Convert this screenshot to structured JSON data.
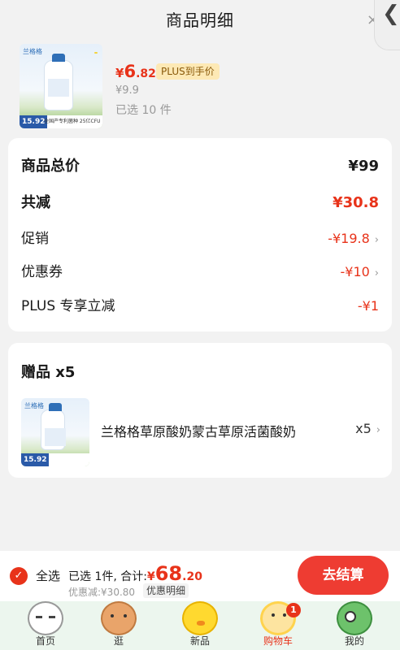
{
  "header": {
    "title": "商品明细",
    "close_glyph": "×",
    "back_glyph": "❮"
  },
  "product": {
    "currency": "¥",
    "price_int": "6",
    "price_dec": ".82",
    "plus_tag": "PLUS到手价",
    "original_price": "¥9.9",
    "selected_count": "已选 10 件",
    "thumb_brand": "兰格格",
    "thumb_price": "15.92",
    "thumb_caption": "全国产专利菌种 25亿CFU"
  },
  "summary": {
    "rows": [
      {
        "key": "商品总价",
        "value": "¥99"
      },
      {
        "key": "共减",
        "value": "¥30.8"
      },
      {
        "key": "促销",
        "value": "-¥19.8"
      },
      {
        "key": "优惠券",
        "value": "-¥10"
      },
      {
        "key": "PLUS 专享立减",
        "value": "-¥1"
      }
    ],
    "arrow": "›"
  },
  "gifts": {
    "title": "赠品 x5",
    "item_name": "兰格格草原酸奶蒙古草原活菌酸奶",
    "item_qty": "x5",
    "arrow": "›",
    "thumb_brand": "兰格格",
    "thumb_price": "15.92"
  },
  "checkout": {
    "check_glyph": "✓",
    "select_all": "全选",
    "selected_text": "已选 1件, 合计:",
    "currency": "¥",
    "total_int": "68",
    "total_dec": ".20",
    "discount_text": "优惠减:¥30.80",
    "detail_label": "优惠明细",
    "pay_label": "去结算"
  },
  "tabbar": {
    "tabs": [
      {
        "label": "首页",
        "icon": "cat-icon"
      },
      {
        "label": "逛",
        "icon": "bear-icon"
      },
      {
        "label": "新品",
        "icon": "chick-icon"
      },
      {
        "label": "购物车",
        "icon": "flower-icon",
        "badge": "1"
      },
      {
        "label": "我的",
        "icon": "fish-icon"
      }
    ]
  },
  "colors": {
    "accent": "#e8331a",
    "pay_button": "#ee3c32",
    "tabbar_bg": "#ecf6ee",
    "plus_tag_bg": "#fde9b5"
  }
}
